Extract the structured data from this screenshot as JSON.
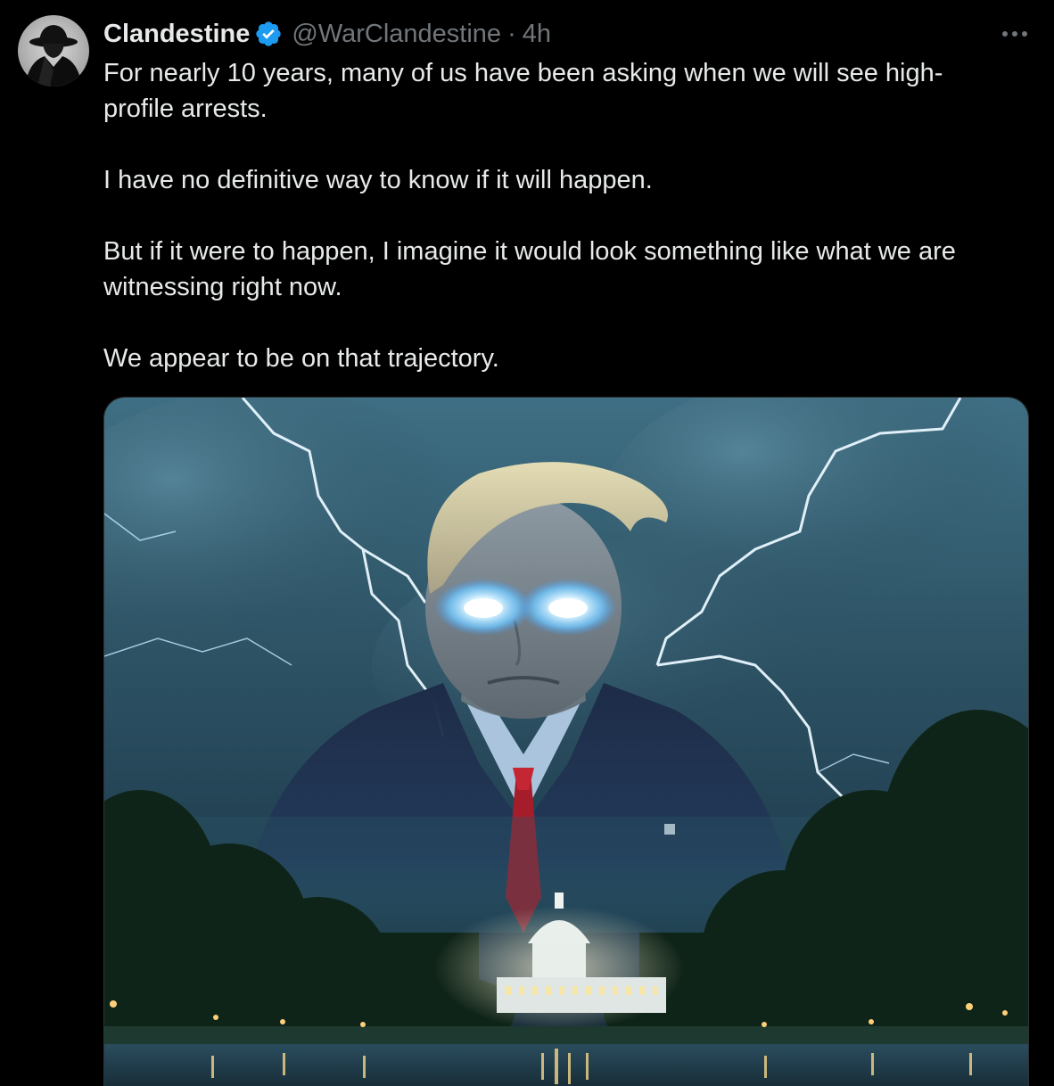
{
  "tweet": {
    "display_name": "Clandestine",
    "handle": "@WarClandestine",
    "separator": "·",
    "time": "4h",
    "paragraphs": [
      "For nearly 10 years, many of us have been asking when we will see high-\nprofile arrests.",
      "I have no definitive way to know if it will happen.",
      "But if it were to happen, I imagine it would look something like what we are\nwitnessing right now.",
      "We appear to be on that trajectory."
    ],
    "avatar_icon": "fedora-silhouette-avatar",
    "verified_icon": "verified-badge-icon",
    "more_icon": "more-options-icon",
    "media": {
      "description_icon": "ai-image-figure-with-glowing-eyes-capitol-lightning"
    }
  },
  "colors": {
    "background": "#000000",
    "text_primary": "#e7e9ea",
    "text_secondary": "#71767b",
    "verified_blue": "#1d9bf0"
  }
}
